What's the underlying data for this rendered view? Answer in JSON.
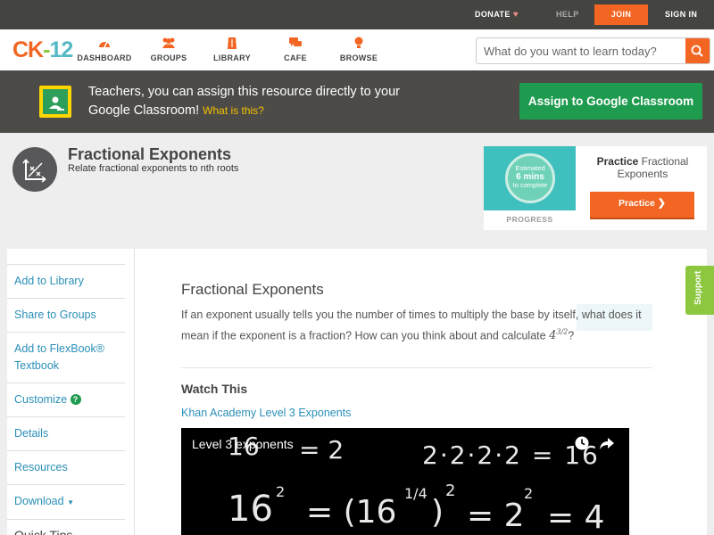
{
  "topbar": {
    "donate": "DONATE",
    "help": "HELP",
    "join": "JOIN",
    "signin": "SIGN IN"
  },
  "logo": {
    "ck": "CK",
    "dash": "-",
    "num": "12"
  },
  "nav": {
    "items": [
      {
        "label": "DASHBOARD",
        "icon": "dashboard-icon"
      },
      {
        "label": "GROUPS",
        "icon": "groups-icon"
      },
      {
        "label": "LIBRARY",
        "icon": "library-icon"
      },
      {
        "label": "CAFE",
        "icon": "cafe-icon"
      },
      {
        "label": "BROWSE",
        "icon": "browse-icon"
      }
    ],
    "search_placeholder": "What do you want to learn today?"
  },
  "banner": {
    "text": "Teachers, you can assign this resource directly to your Google Classroom!",
    "what_link": "What is this?",
    "assign_button": "Assign to Google Classroom"
  },
  "concept": {
    "title": "Fractional Exponents",
    "subtitle": "Relate fractional exponents to nth roots"
  },
  "practice": {
    "estimated": "Estimated",
    "mins": "6 mins",
    "to_complete": "to complete",
    "progress": "PROGRESS",
    "title_bold": "Practice",
    "title_rest": " Fractional Exponents",
    "button": "Practice"
  },
  "sidebar": {
    "items": [
      "Add to Library",
      "Share to Groups",
      "Add to FlexBook® Textbook",
      "Customize",
      "Details",
      "Resources",
      "Download"
    ],
    "quick_tips": "Quick Tips"
  },
  "article": {
    "title": "Fractional Exponents",
    "question": "If an exponent usually tells you the number of times to multiply the base by itself, what does it mean if the exponent is a fraction? How can you think about and calculate",
    "math_base": "4",
    "math_exp": "3/2",
    "question_end": "?",
    "watch_title": "Watch This",
    "watch_link": "Khan Academy Level 3 Exponents"
  },
  "video": {
    "title": "Level 3 exponents"
  },
  "support": "Support",
  "colors": {
    "accent_orange": "#f26522",
    "google_green": "#1f9b4f",
    "link_blue": "#2a8fb8",
    "support_green": "#8dc63f"
  }
}
